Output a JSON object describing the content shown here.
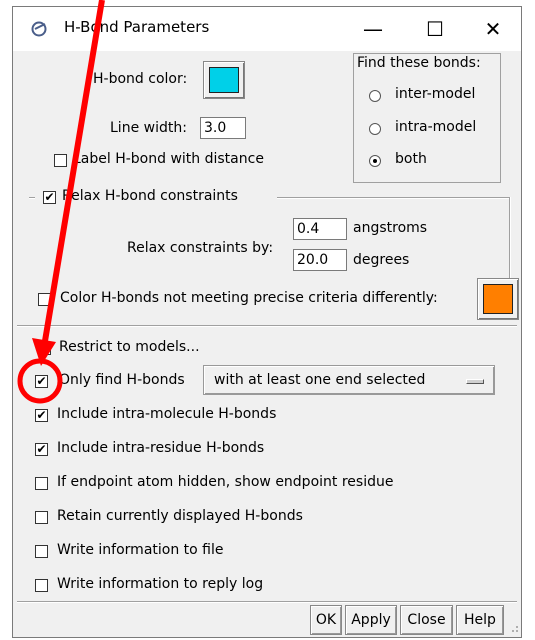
{
  "window": {
    "title": "H-Bond Parameters",
    "minimize": "—",
    "maximize": "☐",
    "close": "✕"
  },
  "color": {
    "label": "H-bond color:",
    "hbond_color": "#00d0e8",
    "line_width_label": "Line width:",
    "line_width": "3.0",
    "label_with_distance": "Label H-bond with distance",
    "label_with_distance_checked": false
  },
  "find": {
    "title": "Find these bonds:",
    "options": [
      {
        "label": "inter-model",
        "selected": false
      },
      {
        "label": "intra-model",
        "selected": false
      },
      {
        "label": "both",
        "selected": true
      }
    ]
  },
  "relax": {
    "label": "Relax H-bond constraints",
    "checked": true,
    "by_label": "Relax constraints by:",
    "distance": "0.4",
    "distance_unit": "angstroms",
    "angle": "20.0",
    "angle_unit": "degrees",
    "color_diff_label": "Color H-bonds not meeting precise criteria differently:",
    "color_diff_checked": false,
    "diff_color": "#ff7f00"
  },
  "options": {
    "restrict_label": "Restrict to models...",
    "restrict_checked": false,
    "only_find_label": "Only find H-bonds",
    "only_find_checked": true,
    "only_find_value": "with at least one end selected",
    "intra_molecule_label": "Include intra-molecule H-bonds",
    "intra_molecule_checked": true,
    "intra_residue_label": "Include intra-residue H-bonds",
    "intra_residue_checked": true,
    "hidden_label": "If endpoint atom hidden, show endpoint residue",
    "hidden_checked": false,
    "retain_label": "Retain currently displayed H-bonds",
    "retain_checked": false,
    "write_file_label": "Write information to file",
    "write_file_checked": false,
    "reply_log_label": "Write information to reply log",
    "reply_log_checked": false
  },
  "buttons": {
    "ok": "OK",
    "apply": "Apply",
    "close": "Close",
    "help": "Help"
  },
  "annotation": {
    "color": "#ff0000"
  }
}
